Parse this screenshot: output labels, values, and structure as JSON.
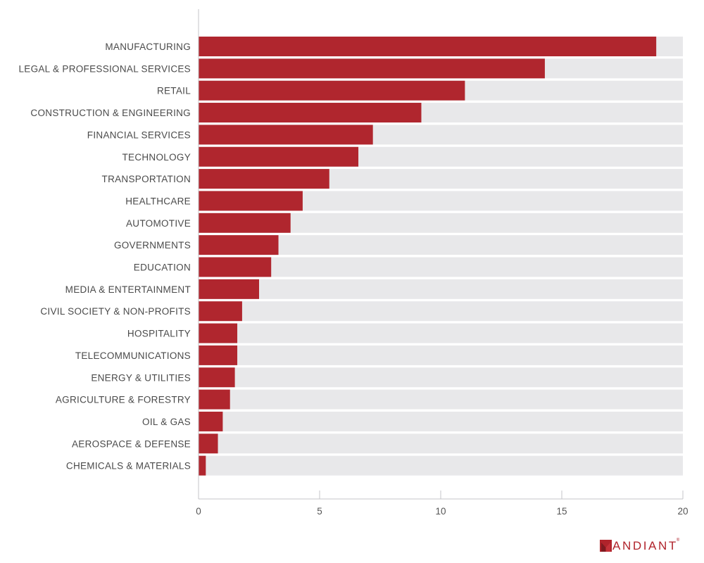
{
  "chart_data": {
    "type": "bar",
    "orientation": "horizontal",
    "title": "",
    "xlabel": "",
    "ylabel": "",
    "xlim": [
      0,
      20
    ],
    "x_ticks": [
      "0",
      "5",
      "10",
      "15",
      "20"
    ],
    "x_tick_values": [
      0,
      5,
      10,
      15,
      20
    ],
    "grid": false,
    "legend": "none",
    "bar_color": "#b0262e",
    "track_color": "#e8e8ea",
    "categories": [
      "MANUFACTURING",
      "LEGAL & PROFESSIONAL SERVICES",
      "RETAIL",
      "CONSTRUCTION & ENGINEERING",
      "FINANCIAL SERVICES",
      "TECHNOLOGY",
      "TRANSPORTATION",
      "HEALTHCARE",
      "AUTOMOTIVE",
      "GOVERNMENTS",
      "EDUCATION",
      "MEDIA & ENTERTAINMENT",
      "CIVIL SOCIETY & NON-PROFITS",
      "HOSPITALITY",
      "TELECOMMUNICATIONS",
      "ENERGY & UTILITIES",
      "AGRICULTURE & FORESTRY",
      "OIL & GAS",
      "AEROSPACE & DEFENSE",
      "CHEMICALS & MATERIALS"
    ],
    "values": [
      18.9,
      14.3,
      11.0,
      9.2,
      7.2,
      6.6,
      5.4,
      4.3,
      3.8,
      3.3,
      3.0,
      2.5,
      1.8,
      1.6,
      1.6,
      1.5,
      1.3,
      1.0,
      0.8,
      0.3
    ]
  },
  "branding": {
    "logo_text": "ANDIANT",
    "logo_mark": "M",
    "logo_reg": "®",
    "brand_color": "#b0232b"
  }
}
